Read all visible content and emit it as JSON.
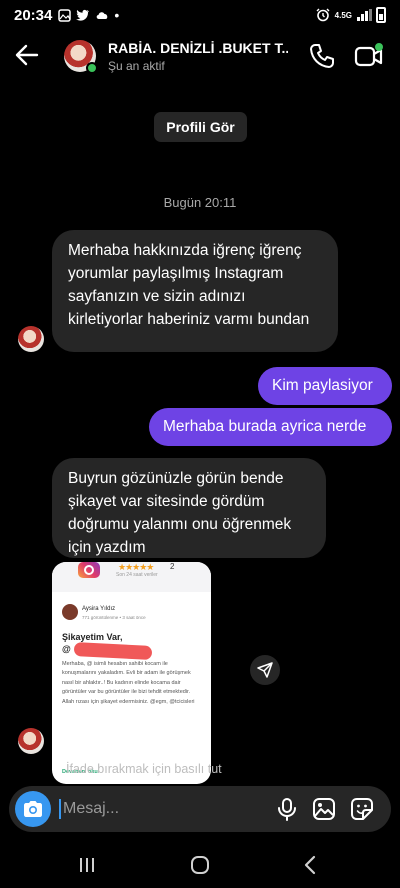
{
  "status_bar": {
    "time": "20:34",
    "network": "4.5G",
    "signal_label": "LTE1"
  },
  "header": {
    "contact_name": "RABİA. DENİZLİ .BUKET T...",
    "contact_status": "Şu an aktif"
  },
  "profile_button": "Profili Gör",
  "timestamp": "Bugün 20:11",
  "messages": [
    {
      "from": "them",
      "text": "Merhaba hakkınızda iğrenç iğrenç yorumlar paylaşılmış Instagram sayfanızın ve sizin adınızı kirletiyorlar haberiniz varmı bundan"
    },
    {
      "from": "me",
      "text": "Kim paylasiyor"
    },
    {
      "from": "me",
      "text": "Merhaba burada ayrica nerde"
    },
    {
      "from": "them",
      "text": "Buyrun gözünüzle görün bende şikayet var sitesinde gördüm doğrumu yalanmı onu öğrenmek için yazdım"
    }
  ],
  "shared_image": {
    "rating": "2",
    "views_text": "Son 24 saat veriler",
    "author": "Aysira Yıldız",
    "author_meta": "771 görüntülenme • 3 saat önce",
    "title": "Şikayetim Var,",
    "at_sign": "@",
    "body": "Merhaba, @ isimli hesabın sahibi kocam ile konuşmalarını yakaladım. Evli bir adam ile görüşmek nasıl bir ahlaktır..! Bu kadının elinde kocama dair görüntüler var bu görüntüler ile bizi tehdit etmektedir. Allah rızası için şikayet edermisiniz. @egm, @tcicisleri",
    "read_more": "Devamını oku"
  },
  "reaction_hint": "İfade bırakmak için basılı tut",
  "composer": {
    "placeholder": "Mesaj..."
  },
  "colors": {
    "outgoing_bubble": "#6e43e5",
    "incoming_bubble": "#262626",
    "accent_blue": "#3797f0",
    "online": "#3ac25a"
  }
}
